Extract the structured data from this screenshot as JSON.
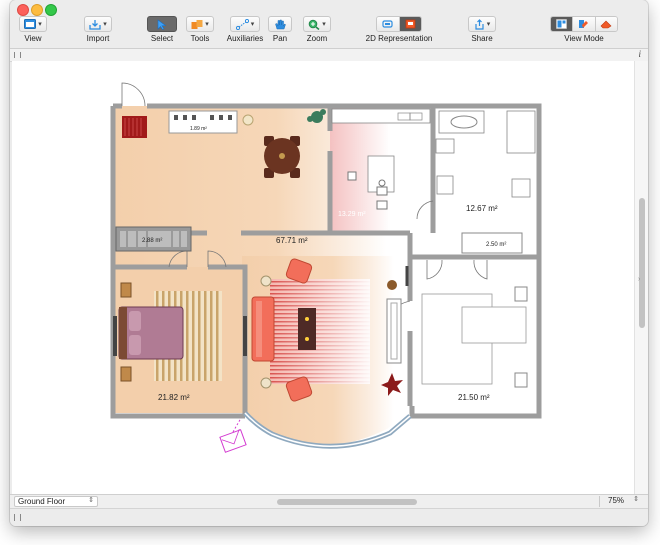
{
  "toolbar": {
    "view": "View",
    "import": "Import",
    "select": "Select",
    "tools": "Tools",
    "auxiliaries": "Auxiliaries",
    "pan": "Pan",
    "zoom": "Zoom",
    "representation": "2D Representation",
    "share": "Share",
    "view_mode": "View Mode"
  },
  "info_button": "i",
  "floorplan": {
    "area_living": "67.71 m²",
    "area_bedroom": "21.82 m²",
    "area_bath_top_right": "12.67 m²",
    "area_bath_right": "21.50 m²",
    "area_kitchen": "13.29 m²",
    "area_closet": "2.88 m²",
    "area_small_right": "2.50 m²",
    "area_shelf": "1.89 m²"
  },
  "footer": {
    "floor_select": "Ground Floor",
    "zoom_level": "75%"
  }
}
